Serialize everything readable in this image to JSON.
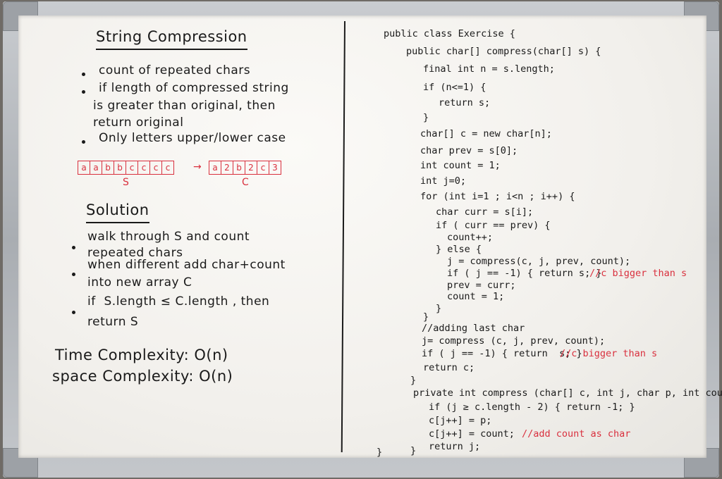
{
  "left": {
    "title": "String Compression",
    "bullets": [
      "count of repeated chars",
      "if length of compressed string",
      "is greater than original, then",
      "return original",
      "Only letters upper/lower case"
    ],
    "array_s": [
      "a",
      "a",
      "b",
      "b",
      "c",
      "c",
      "c",
      "c"
    ],
    "array_s_label": "S",
    "array_c": [
      "a",
      "2",
      "b",
      "2",
      "c",
      "3"
    ],
    "array_c_label": "C",
    "arrow": "→",
    "solution_title": "Solution",
    "solution_lines": [
      "walk through S and count",
      "repeated chars",
      "when different add char+count",
      "into new array C",
      "if  S.length ≤ C.length , then",
      "return S"
    ],
    "time_complexity": "Time Complexity: O(n)",
    "space_complexity": "space Complexity: O(n)"
  },
  "code": {
    "lines": [
      "public class Exercise {",
      "public char[] compress(char[] s) {",
      "final int n = s.length;",
      "if (n<=1) {",
      "return s;",
      "}",
      "char[] c = new char[n];",
      "char prev = s[0];",
      "int count = 1;",
      "int j=0;",
      "for (int i=1 ; i<n ; i++) {",
      "char curr = s[i];",
      "if ( curr == prev) {",
      "count++;",
      "} else {",
      "j = compress(c, j, prev, count);",
      "if ( j == -1) { return s; }",
      "prev = curr;",
      "count = 1;",
      "}",
      "}",
      "//adding last char",
      "j= compress (c, j, prev, count);",
      "if ( j == -1) { return  s; }",
      "return c;",
      "}",
      "private int compress (char[] c, int j, char p, int count) {",
      "if (j ≥ c.length - 2) { return -1; }",
      "c[j++] = p;",
      "c[j++] = count;",
      "return j;",
      "}",
      "}"
    ],
    "comment_1": "//c bigger than s",
    "comment_2": "//c bigger than s",
    "comment_3": "//add count as char"
  },
  "colors": {
    "ink": "#1a1a1a",
    "red_marker": "#d9303e",
    "board": "#f5f3ef",
    "frame": "#b5b9bd"
  }
}
